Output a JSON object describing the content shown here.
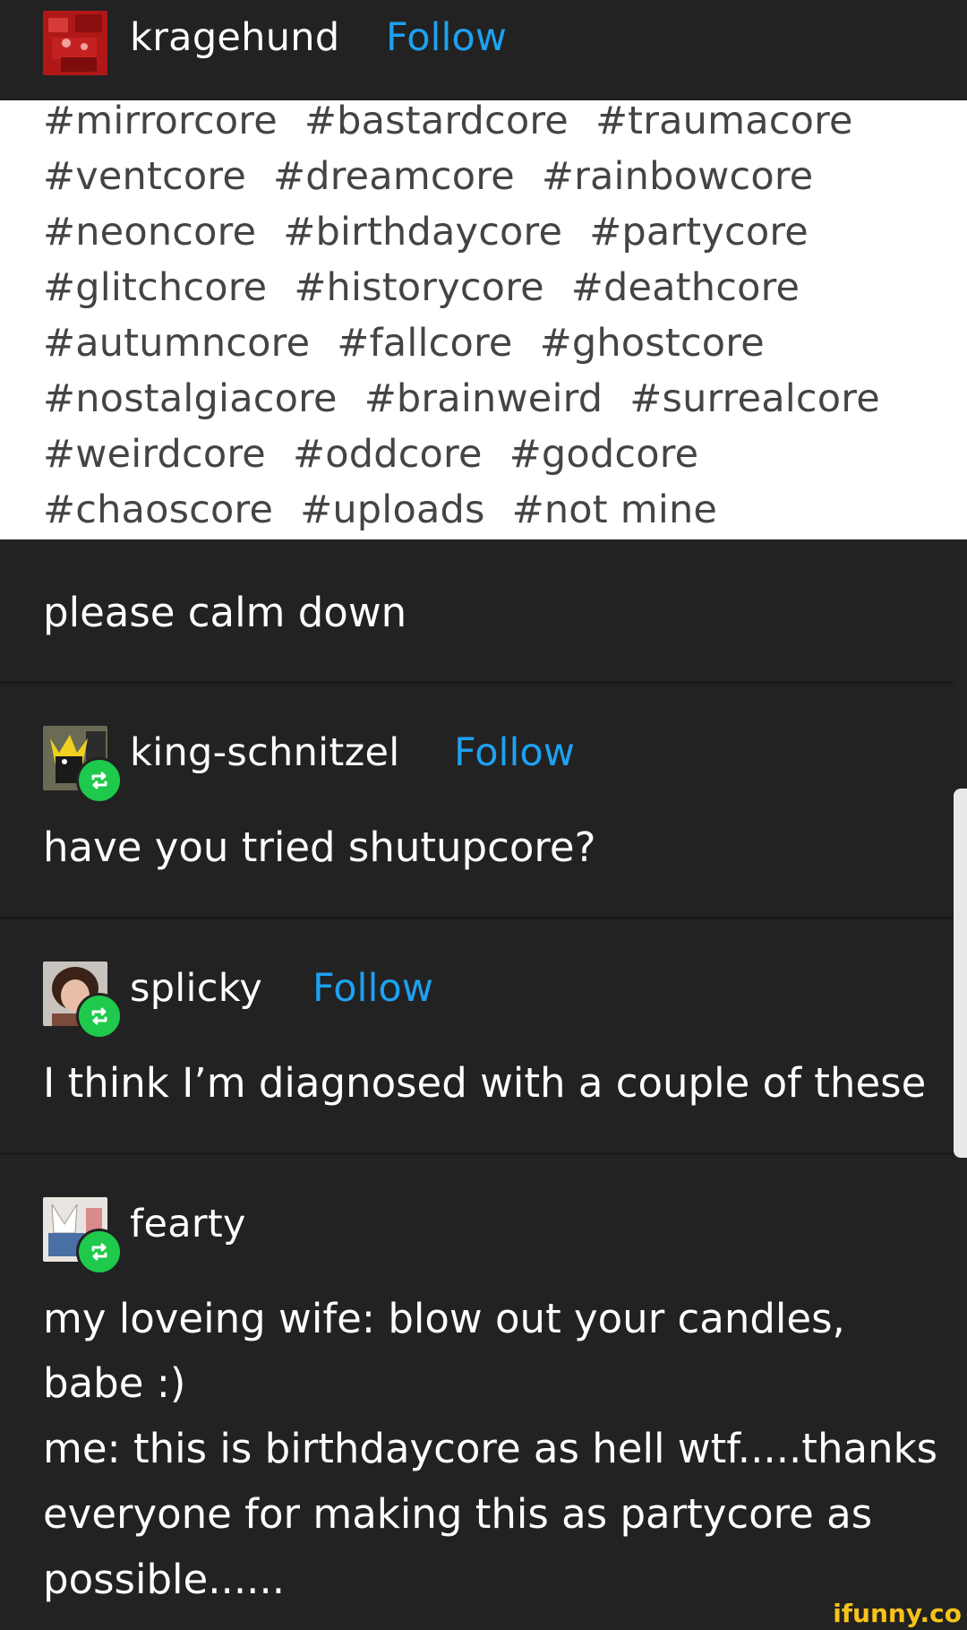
{
  "op": {
    "username": "kragehund",
    "follow_label": "Follow",
    "tags": [
      [
        "#mirrorcore",
        "#bastardcore",
        "#traumacore"
      ],
      [
        "#ventcore",
        "#dreamcore",
        "#rainbowcore"
      ],
      [
        "#neoncore",
        "#birthdaycore",
        "#partycore"
      ],
      [
        "#glitchcore",
        "#historycore",
        "#deathcore"
      ],
      [
        "#autumncore",
        "#fallcore",
        "#ghostcore"
      ],
      [
        "#nostalgiacore",
        "#brainweird",
        "#surrealcore"
      ],
      [
        "#weirdcore",
        "#oddcore",
        "#godcore"
      ],
      [
        "#chaoscore",
        "#uploads",
        "#not mine"
      ]
    ],
    "comment": "please calm down"
  },
  "reblogs": [
    {
      "username": "king-schnitzel",
      "follow_label": "Follow",
      "text": "have you tried shutupcore?"
    },
    {
      "username": "splicky",
      "follow_label": "Follow",
      "text": "I think I’m diagnosed with a couple of these"
    },
    {
      "username": "fearty",
      "text_lines": [
        "my loveing wife: blow out your candles,",
        "babe :)",
        "me: this is birthdaycore as hell wtf.....thanks",
        "everyone for making this as partycore as",
        "possible......"
      ]
    }
  ],
  "watermark": "ifunny.co",
  "icons": {
    "reblog": "reblog-icon"
  },
  "colors": {
    "background": "#222222",
    "follow": "#1ea1f2",
    "reblog_badge": "#1ec94b",
    "tag_text": "#444444",
    "watermark": "#f7c21b"
  }
}
